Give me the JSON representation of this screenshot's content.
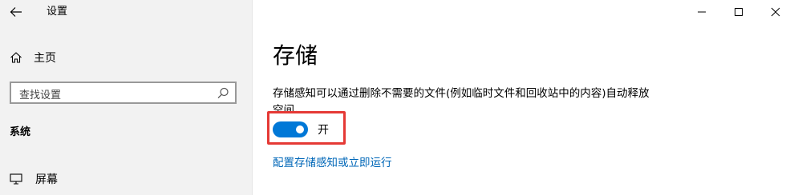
{
  "window": {
    "title": "设置",
    "controls": {
      "minimize": "minimize-icon",
      "maximize": "maximize-icon",
      "close": "close-icon"
    }
  },
  "sidebar": {
    "home_label": "主页",
    "search_placeholder": "查找设置",
    "section_header": "系统",
    "items": [
      {
        "label": "屏幕",
        "icon": "monitor-icon"
      }
    ]
  },
  "main": {
    "title": "存储",
    "description": "存储感知可以通过删除不需要的文件(例如临时文件和回收站中的内容)自动释放空间。",
    "toggle": {
      "state": "on",
      "label": "开"
    },
    "config_link": "配置存储感知或立即运行"
  },
  "colors": {
    "accent": "#0078d7",
    "link": "#0067b8",
    "highlight": "#e53935",
    "sidebar_bg": "#f2f2f2"
  }
}
